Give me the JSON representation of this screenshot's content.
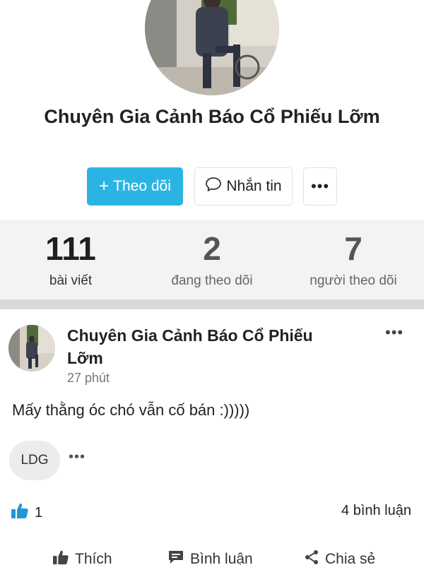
{
  "profile": {
    "name": "Chuyên Gia Cảnh Báo Cổ Phiếu Lỡm",
    "follow_button": "Theo dõi",
    "message_button": "Nhắn tin",
    "more_button": "•••"
  },
  "stats": [
    {
      "value": "111",
      "label": "bài viết"
    },
    {
      "value": "2",
      "label": "đang theo dõi"
    },
    {
      "value": "7",
      "label": "người theo dõi"
    }
  ],
  "post": {
    "author": "Chuyên Gia Cảnh Báo Cổ Phiếu Lỡm",
    "time": "27 phút",
    "content": "Mấy thằng óc chó vẫn cố bán :)))))",
    "more": "•••",
    "tag": "LDG",
    "tag_more": "•••",
    "likes": "1",
    "comments": "4 bình luận"
  },
  "actions": {
    "like": "Thích",
    "comment": "Bình luận",
    "share": "Chia sẻ"
  },
  "colors": {
    "accent": "#2bb4e3",
    "like_icon": "#2196d9",
    "stats_bg": "#f3f3f3"
  }
}
